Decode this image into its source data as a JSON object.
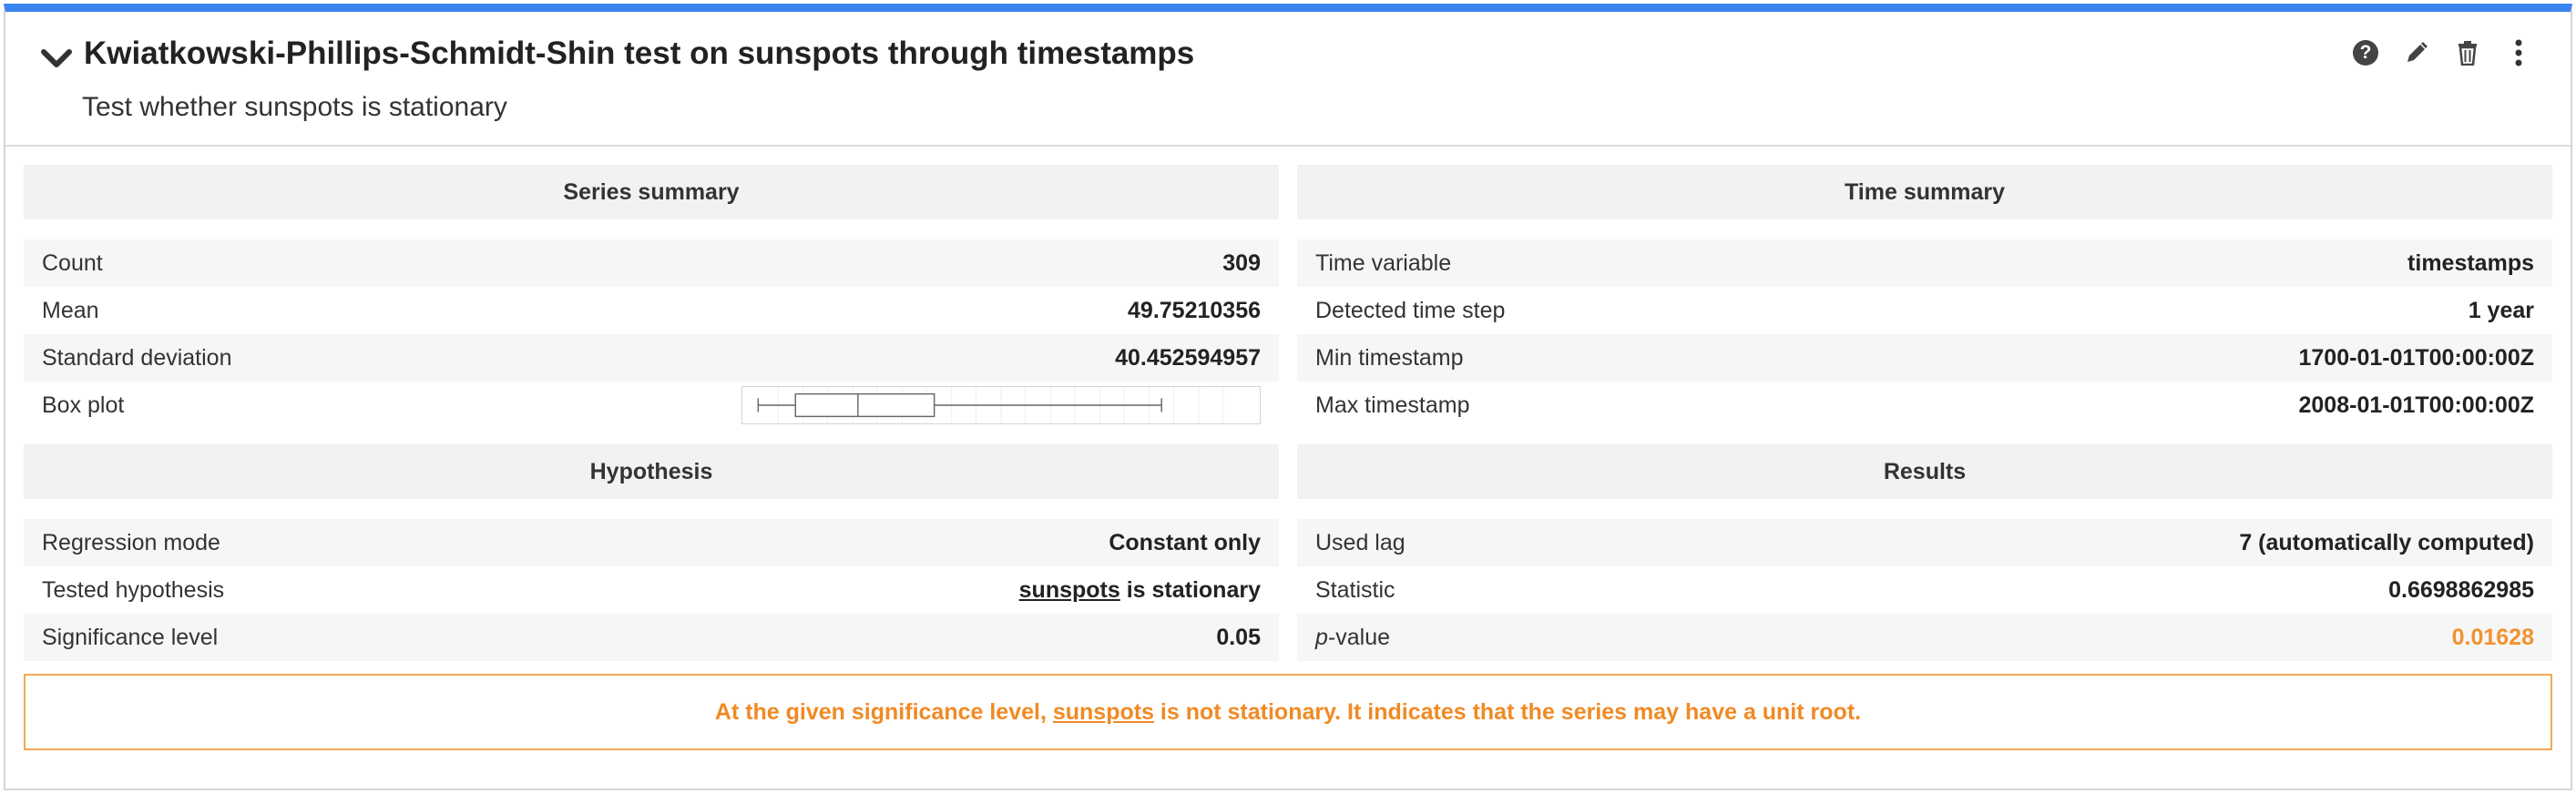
{
  "card": {
    "title": "Kwiatkowski-Phillips-Schmidt-Shin test on sunspots through timestamps",
    "subtitle": "Test whether sunspots is stationary",
    "actions": [
      "help-icon",
      "pencil-icon",
      "trash-icon",
      "more-vertical-icon"
    ],
    "accent_color": "#3b84f0"
  },
  "series_summary": {
    "heading": "Series summary",
    "rows": [
      {
        "label": "Count",
        "value": "309"
      },
      {
        "label": "Mean",
        "value": "49.75210356"
      },
      {
        "label": "Standard deviation",
        "value": "40.452594957"
      },
      {
        "label": "Box plot"
      }
    ]
  },
  "time_summary": {
    "heading": "Time summary",
    "rows": [
      {
        "label": "Time variable",
        "value": "timestamps"
      },
      {
        "label": "Detected time step",
        "value": "1 year"
      },
      {
        "label": "Min timestamp",
        "value": "1700-01-01T00:00:00Z"
      },
      {
        "label": "Max timestamp",
        "value": "2008-01-01T00:00:00Z"
      }
    ]
  },
  "hypothesis": {
    "heading": "Hypothesis",
    "rows": [
      {
        "label": "Regression mode",
        "value": "Constant only"
      },
      {
        "label": "Tested hypothesis",
        "value_link": "sunspots",
        "value_rest": " is stationary"
      },
      {
        "label": "Significance level",
        "value": "0.05"
      }
    ]
  },
  "results": {
    "heading": "Results",
    "rows": [
      {
        "label_italic": "p",
        "label": "Used lag",
        "value": "7 (automatically computed)"
      },
      {
        "label": "Statistic",
        "value": "0.6698862985"
      },
      {
        "label_italic": "p",
        "label_rest": "-value",
        "value": "0.01628",
        "value_color": "#f2922e"
      }
    ]
  },
  "conclusion": {
    "prefix": "At the given significance level, ",
    "link": "sunspots",
    "suffix": " is not stationary. It indicates that the series may have a unit root.",
    "color": "#f08a24"
  }
}
